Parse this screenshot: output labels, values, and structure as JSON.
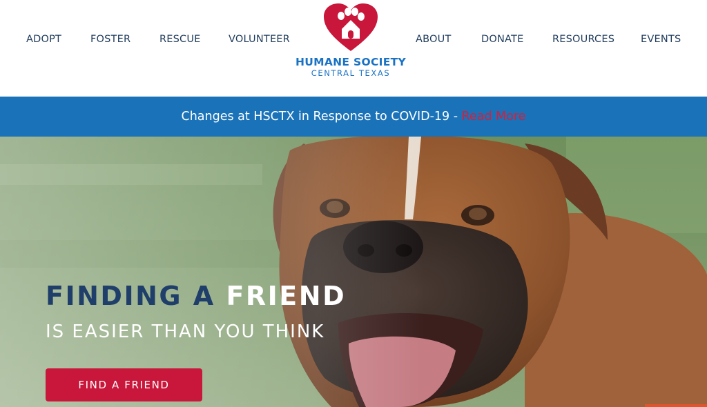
{
  "nav": {
    "left": [
      "ADOPT",
      "FOSTER",
      "RESCUE",
      "VOLUNTEER"
    ],
    "right": [
      "ABOUT",
      "DONATE",
      "RESOURCES",
      "EVENTS"
    ]
  },
  "logo": {
    "name": "HUMANE SOCIETY",
    "sub": "CENTRAL TEXAS",
    "icon": "heart-paw-house-icon"
  },
  "banner": {
    "text": "Changes at HSCTX in Response to COVID-19 - ",
    "link": "Read More"
  },
  "hero": {
    "line1_a": "FINDING A ",
    "line1_b": "FRIEND",
    "line2": "IS EASIER THAN YOU THINK",
    "button": "FIND A FRIEND"
  },
  "colors": {
    "nav_text": "#1f3b5c",
    "logo_blue": "#1a72c4",
    "logo_red": "#c8173a",
    "banner_bg": "#1a72b9",
    "banner_link": "#d61f3b",
    "cta_bg": "#c8173a",
    "hero_dark_text": "#1f3e6a"
  }
}
